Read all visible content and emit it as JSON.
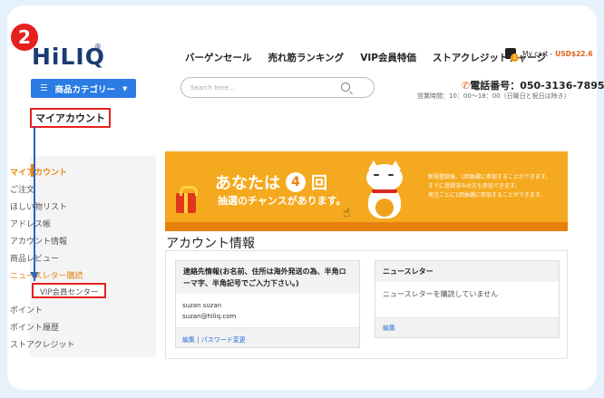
{
  "step": {
    "number": "2"
  },
  "header": {
    "logo_text": "HiLIQ",
    "logo_reg": "®",
    "nav": [
      "バーゲンセール",
      "売れ筋ランキング",
      "VIP会員特価",
      "ストアクレジットチャージ"
    ],
    "cart_label": "My cart -",
    "cart_amount": "USD$22.6",
    "cart_count": "1",
    "category_button": "商品カテゴリー",
    "search_placeholder": "Search here...",
    "phone": "電話番号：050-3136-7895",
    "hours": "営業時間：10：00〜18：00（日曜日と祝日は除き）"
  },
  "page_title": "マイアカウント",
  "sidebar": {
    "items": [
      {
        "label": "マイアカウント"
      },
      {
        "label": "ご注文"
      },
      {
        "label": "ほしい物リスト"
      },
      {
        "label": "アドレス帳"
      },
      {
        "label": "アカウント情報"
      },
      {
        "label": "商品レビュー"
      },
      {
        "label": "ニュースレター購読"
      },
      {
        "label": "VIP会員センター"
      },
      {
        "label": "ポイント"
      },
      {
        "label": "ポイント履歴"
      },
      {
        "label": "ストアクレジット"
      }
    ]
  },
  "banner": {
    "line1_pre": "あなたは",
    "count": "4",
    "line1_post": "回",
    "line2": "抽選のチャンスがあります。",
    "small": [
      "新規登録後、1回抽選に参加することができます。",
      "すでに登録済みの方も参加できます。",
      "発注ごとに1回抽選に参加することができます。"
    ]
  },
  "main": {
    "section_title": "アカウント情報",
    "contact": {
      "title": "連絡先情報(お名前、住所は海外発送の為、半角ローマ字、半角記号でご入力下さい。)",
      "name": "suzan suzan",
      "email": "suzan@hiliq.com",
      "links": "編集 | パスワード変更"
    },
    "newsletter": {
      "title": "ニュースレター",
      "status": "ニュースレターを購読していません",
      "edit": "編集"
    }
  },
  "colors": {
    "accent_orange": "#e8830f",
    "highlight_red": "#e5201e",
    "primary_blue": "#2a7be4",
    "banner_orange": "#f5a91e"
  }
}
